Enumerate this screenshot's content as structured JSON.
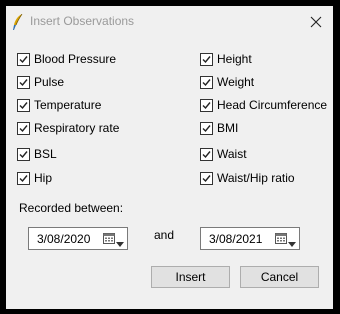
{
  "window": {
    "title": "Insert Observations"
  },
  "checkboxes_left": [
    {
      "label": "Blood Pressure",
      "checked": true
    },
    {
      "label": "Pulse",
      "checked": true
    },
    {
      "label": "Temperature",
      "checked": true
    },
    {
      "label": "Respiratory rate",
      "checked": true
    },
    {
      "label": "BSL",
      "checked": true
    },
    {
      "label": "Hip",
      "checked": true
    }
  ],
  "checkboxes_right": [
    {
      "label": "Height",
      "checked": true
    },
    {
      "label": "Weight",
      "checked": true
    },
    {
      "label": "Head Circumference",
      "checked": true
    },
    {
      "label": "BMI",
      "checked": true
    },
    {
      "label": "Waist",
      "checked": true
    },
    {
      "label": "Waist/Hip ratio",
      "checked": true
    }
  ],
  "recorded_between_label": "Recorded between:",
  "and_label": "and",
  "date_from": {
    "value": "3/08/2020"
  },
  "date_to": {
    "value": "3/08/2021"
  },
  "buttons": {
    "insert": "Insert",
    "cancel": "Cancel"
  },
  "icons": {
    "app": "feather-pen-icon",
    "close": "close-icon",
    "calendar": "calendar-icon",
    "dropdown": "dropdown-arrow-icon",
    "check": "checkmark-icon"
  }
}
